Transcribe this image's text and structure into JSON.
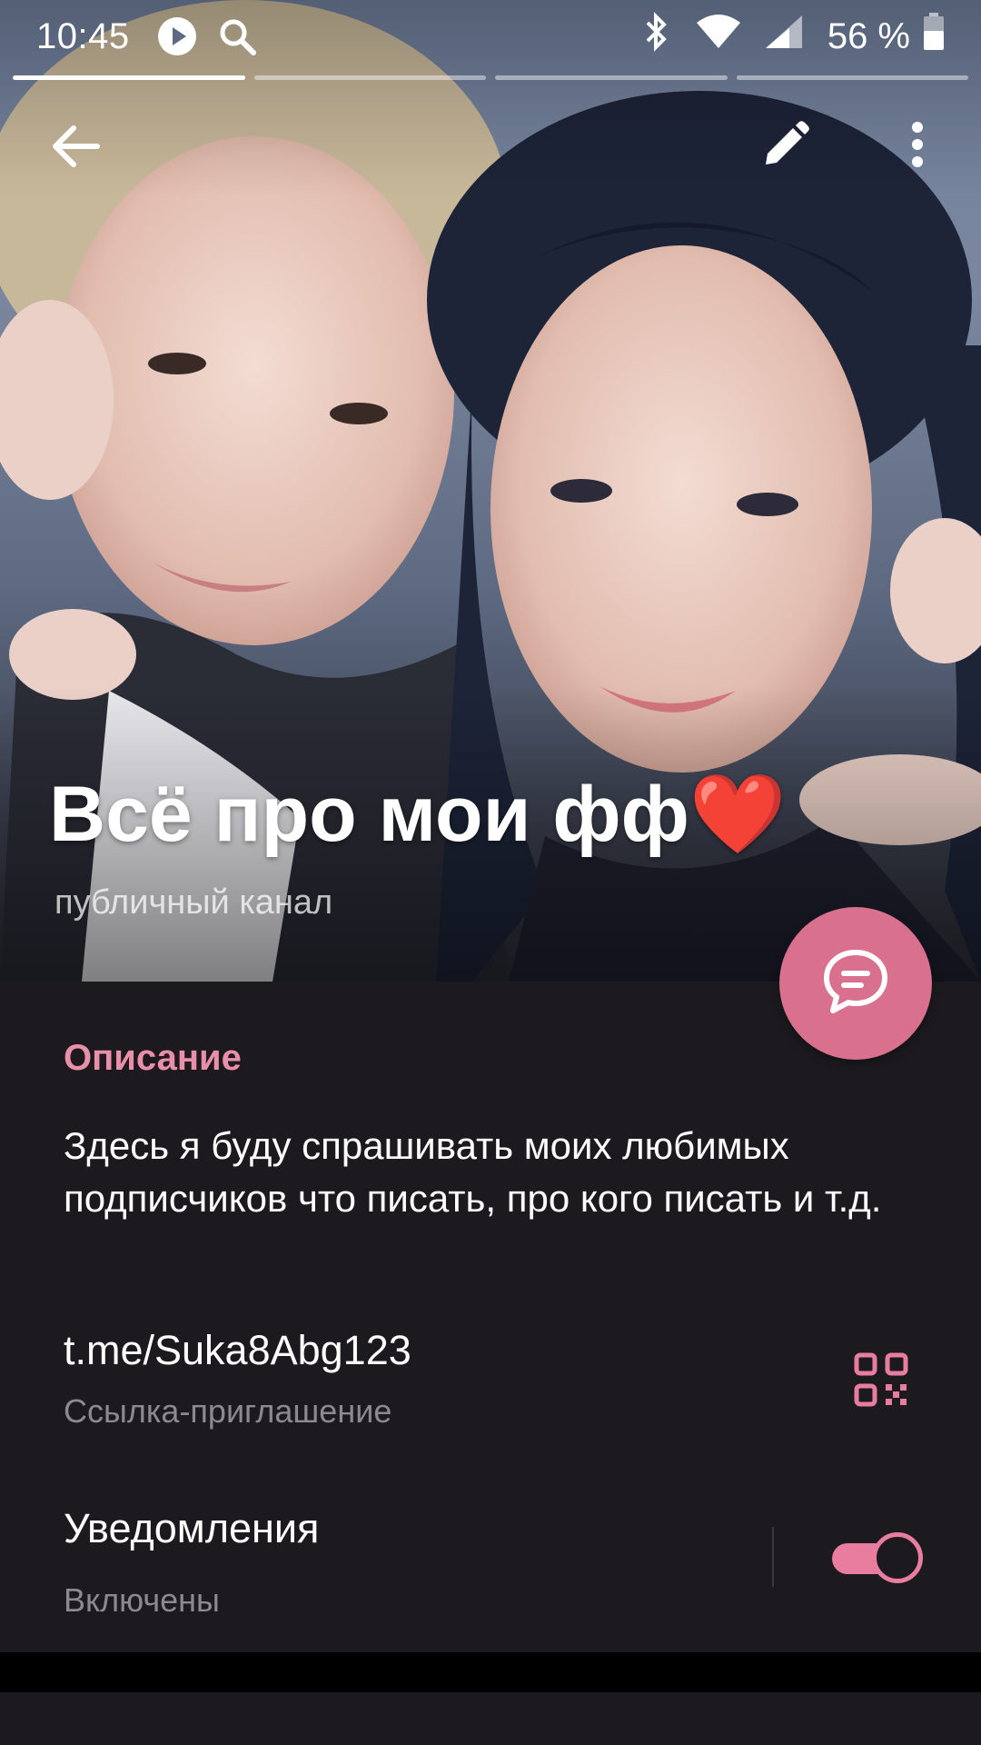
{
  "status_bar": {
    "time": "10:45",
    "battery": "56 %",
    "icons": [
      "play-icon",
      "search-icon",
      "bluetooth-icon",
      "wifi-icon",
      "signal-icon",
      "battery-icon"
    ]
  },
  "toolbar": {
    "icons": [
      "back-arrow-icon",
      "edit-pencil-icon",
      "more-vert-icon"
    ]
  },
  "channel": {
    "title": "Всё про мои фф❤️",
    "subtitle": "публичный канал"
  },
  "info": {
    "section_title": "Описание",
    "description": "Здесь я буду спрашивать моих любимых подписчиков что писать, про кого писать и т.д.",
    "link": "t.me/Suka8Abg123",
    "link_label": "Ссылка-приглашение",
    "notifications_label": "Уведомления",
    "notifications_status": "Включены",
    "notifications_enabled": true
  },
  "colors": {
    "accent": "#e98fa9",
    "fab": "#d9708e",
    "panel_bg": "#1c1a1e",
    "secondary_text": "#8c8990"
  },
  "story_progress": {
    "segments": 4,
    "active_index": 0
  }
}
